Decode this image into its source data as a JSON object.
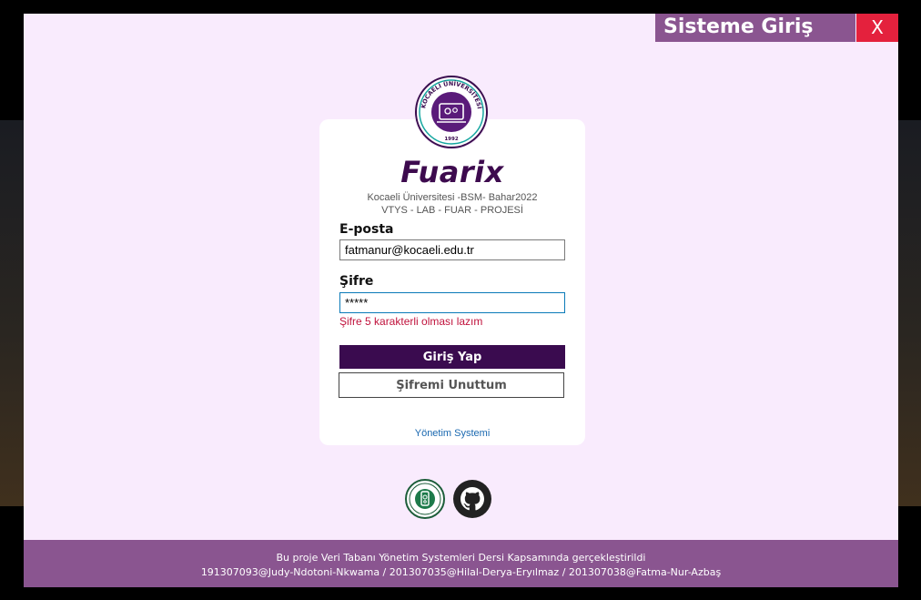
{
  "window": {
    "title": "Sisteme Giriş",
    "close_label": "X",
    "colors": {
      "accent": "#8a5590",
      "close": "#e4213d",
      "primary": "#3a0b4f",
      "background": "#f9ebfd",
      "error": "#c0123c"
    }
  },
  "logo": {
    "icon": "university-seal-icon",
    "ring_text": "KOCAELİ ÜNİVERSİTESİ",
    "year": "1992"
  },
  "header": {
    "app_name": "Fuarix",
    "subtitle_1": "Kocaeli Üniversitesi -BSM- Bahar2022",
    "subtitle_2": "VTYS - LAB - FUAR - PROJESİ"
  },
  "form": {
    "email_label": "E-posta",
    "email_value": "fatmanur@kocaeli.edu.tr",
    "password_label": "Şifre",
    "password_value": "*****",
    "error_message": "Şifre 5 karakterli olması lazım",
    "login_button": "Giriş Yap",
    "forgot_button": "Şifremi Unuttum",
    "admin_link": "Yönetim Systemi"
  },
  "footer": {
    "line_1": "Bu proje Veri Tabanı Yönetim Systemleri Dersi Kapsamında gerçekleştirildi",
    "line_2": "191307093@Judy-Ndotoni-Nkwama / 201307035@Hilal-Derya-Eryılmaz / 201307038@Fatma-Nur-Azbaş"
  },
  "links": {
    "icons": [
      "university-logo-icon",
      "github-icon"
    ]
  }
}
